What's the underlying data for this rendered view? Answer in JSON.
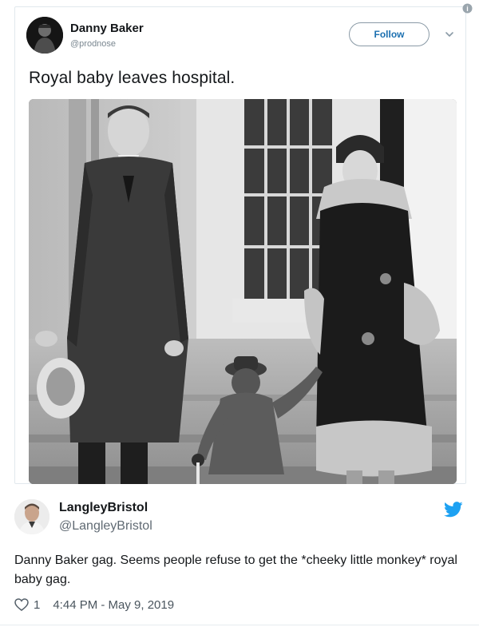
{
  "tweet": {
    "author_name": "Danny Baker",
    "author_handle": "@prodnose",
    "follow_label": "Follow",
    "text": "Royal baby leaves hospital.",
    "info_glyph": "i"
  },
  "reply": {
    "author_name": "LangleyBristol",
    "author_handle": "@LangleyBristol",
    "text": "Danny Baker gag. Seems people refuse to get the *cheeky little monkey* royal baby gag.",
    "like_count": "1",
    "timestamp": "4:44 PM - May 9, 2019"
  },
  "icons": {
    "info": "info-icon",
    "chevron": "chevron-down-icon",
    "twitter": "twitter-bird-icon",
    "like": "heart-icon"
  },
  "colors": {
    "link_blue": "#1b6fb0",
    "twitter_blue": "#1da1f2",
    "muted_text": "#606a73"
  }
}
